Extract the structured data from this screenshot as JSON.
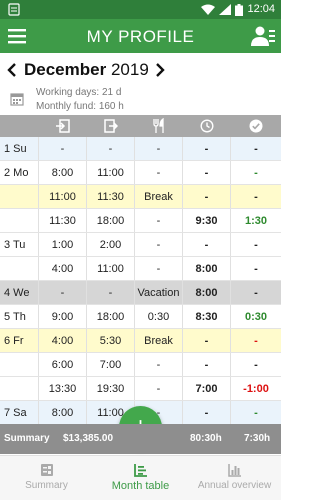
{
  "status_bar": {
    "time": "12:04"
  },
  "app_bar": {
    "title": "MY PROFILE"
  },
  "month": {
    "name": "December",
    "year": "2019"
  },
  "info": {
    "working_days": "Working days:  21 d",
    "monthly_fund": "Monthly fund:  160 h"
  },
  "table": {
    "rows": [
      {
        "day": "1 Su",
        "start": "-",
        "end": "-",
        "break": "-",
        "hours": "-",
        "diff": "-",
        "bg": "blue",
        "hours_bold": true,
        "diff_color": ""
      },
      {
        "day": "2 Mo",
        "start": "8:00",
        "end": "11:00",
        "break": "-",
        "hours": "-",
        "diff": "-",
        "bg": "white",
        "hours_bold": true,
        "diff_color": "green"
      },
      {
        "day": "",
        "start": "11:00",
        "end": "11:30",
        "break": "Break",
        "hours": "-",
        "diff": "-",
        "bg": "yellow",
        "hours_bold": true,
        "diff_color": ""
      },
      {
        "day": "",
        "start": "11:30",
        "end": "18:00",
        "break": "-",
        "hours": "9:30",
        "diff": "1:30",
        "bg": "white",
        "hours_bold": true,
        "diff_color": "green"
      },
      {
        "day": "3 Tu",
        "start": "1:00",
        "end": "2:00",
        "break": "-",
        "hours": "-",
        "diff": "-",
        "bg": "white",
        "hours_bold": true,
        "diff_color": ""
      },
      {
        "day": "",
        "start": "4:00",
        "end": "11:00",
        "break": "-",
        "hours": "8:00",
        "diff": "-",
        "bg": "white",
        "hours_bold": true,
        "diff_color": ""
      },
      {
        "day": "4 We",
        "start": "-",
        "end": "-",
        "break": "Vacation",
        "hours": "8:00",
        "diff": "-",
        "bg": "gray",
        "hours_bold": true,
        "diff_color": ""
      },
      {
        "day": "5 Th",
        "start": "9:00",
        "end": "18:00",
        "break": "0:30",
        "hours": "8:30",
        "diff": "0:30",
        "bg": "white",
        "hours_bold": true,
        "diff_color": "green"
      },
      {
        "day": "6 Fr",
        "start": "4:00",
        "end": "5:30",
        "break": "Break",
        "hours": "-",
        "diff": "-",
        "bg": "yellow",
        "hours_bold": true,
        "diff_color": "red"
      },
      {
        "day": "",
        "start": "6:00",
        "end": "7:00",
        "break": "-",
        "hours": "-",
        "diff": "-",
        "bg": "white",
        "hours_bold": true,
        "diff_color": ""
      },
      {
        "day": "",
        "start": "13:30",
        "end": "19:30",
        "break": "-",
        "hours": "7:00",
        "diff": "-1:00",
        "bg": "white",
        "hours_bold": true,
        "diff_color": "red"
      },
      {
        "day": "7 Sa",
        "start": "8:00",
        "end": "11:00",
        "break": "-",
        "hours": "-",
        "diff": "-",
        "bg": "blue",
        "hours_bold": true,
        "diff_color": "green"
      }
    ]
  },
  "summary": {
    "label": "Summary",
    "amount": "$13,385.00",
    "hours": "80:30h",
    "diff": "7:30h"
  },
  "fab": {
    "symbol": "+"
  },
  "bottom_nav": [
    {
      "label": "Summary",
      "active": false
    },
    {
      "label": "Month table",
      "active": true
    },
    {
      "label": "Annual overview",
      "active": false
    }
  ],
  "colors": {
    "status_bar": "#2f7f3a",
    "app_bar": "#3e9b48",
    "accent": "#43a84c",
    "positive": "#2e8a2e",
    "negative": "#d11111"
  }
}
